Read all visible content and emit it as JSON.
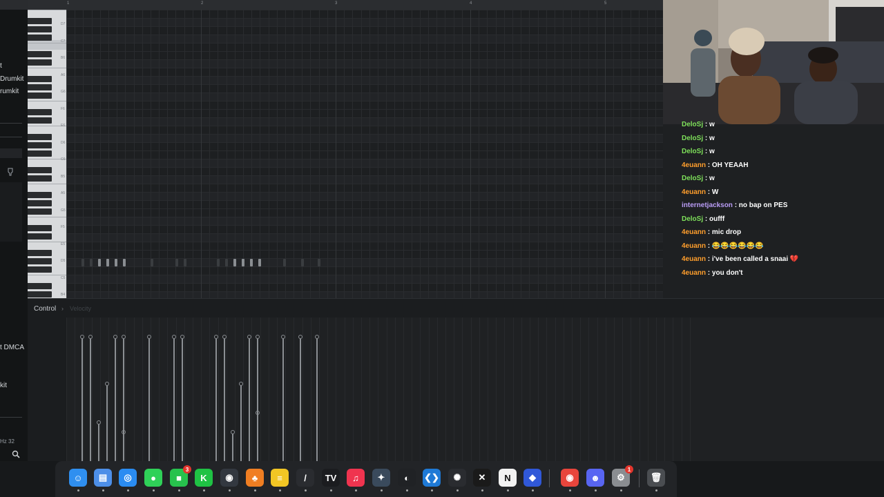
{
  "sidebar": {
    "items": [
      "t",
      "Drumkit",
      "rumkit",
      "t DMCA",
      "kit"
    ],
    "zoom_label": "Hz 32"
  },
  "ruler": {
    "bars": [
      "1",
      "2",
      "3",
      "4",
      "5"
    ]
  },
  "keys": {
    "labels": [
      "D7",
      "C7",
      "B6",
      "A6",
      "G6",
      "F6",
      "E6",
      "D6",
      "C6",
      "B5",
      "A5",
      "G5",
      "F5",
      "E5",
      "D5",
      "C5",
      "B4"
    ]
  },
  "control": {
    "label": "Control",
    "chevron": "›",
    "sub_label": "Velocity"
  },
  "chat": {
    "messages": [
      {
        "user": "DeloSj",
        "text": ": w",
        "color": "#7ee05a"
      },
      {
        "user": "DeloSj",
        "text": ": w",
        "color": "#7ee05a"
      },
      {
        "user": "DeloSj",
        "text": ": w",
        "color": "#7ee05a"
      },
      {
        "user": "4euann",
        "text": ": OH YEAAH",
        "color": "#ff9e2c"
      },
      {
        "user": "DeloSj",
        "text": ": w",
        "color": "#7ee05a"
      },
      {
        "user": "4euann",
        "text": ": W",
        "color": "#ff9e2c"
      },
      {
        "user": "internetjackson",
        "text": ": no bap on PES",
        "color": "#b99cf5"
      },
      {
        "user": "DeloSj",
        "text": ": oufff",
        "color": "#7ee05a"
      },
      {
        "user": "4euann",
        "text": ": mic drop",
        "color": "#ff9e2c"
      },
      {
        "user": "4euann",
        "text": ": 😂😂😂😂😂😂",
        "color": "#ff9e2c"
      },
      {
        "user": "4euann",
        "text": ": i've been called a snaai 💔",
        "color": "#ff9e2c"
      },
      {
        "user": "4euann",
        "text": ": you don't",
        "color": "#ff9e2c"
      }
    ]
  },
  "dock": {
    "apps": [
      {
        "name": "finder-icon",
        "glyph": "☺",
        "bg": "#2f8ff0"
      },
      {
        "name": "files-icon",
        "glyph": "▤",
        "bg": "#4d8fe8"
      },
      {
        "name": "safari-icon",
        "glyph": "◎",
        "bg": "#2a8cf2"
      },
      {
        "name": "messages-icon",
        "glyph": "●",
        "bg": "#2fd158"
      },
      {
        "name": "facetime-icon",
        "glyph": "■",
        "bg": "#27c24d",
        "badge": "3"
      },
      {
        "name": "kick-icon",
        "glyph": "K",
        "bg": "#1fc244"
      },
      {
        "name": "obs-icon",
        "glyph": "◉",
        "bg": "#333840"
      },
      {
        "name": "fl-studio-icon",
        "glyph": "♣",
        "bg": "#f07e22"
      },
      {
        "name": "notes-icon",
        "glyph": "≡",
        "bg": "#f2c624"
      },
      {
        "name": "stylus-icon",
        "glyph": "/",
        "bg": "#2a2c30"
      },
      {
        "name": "tradingview-icon",
        "glyph": "TV",
        "bg": "#1b1c1f"
      },
      {
        "name": "music-icon",
        "glyph": "♫",
        "bg": "#f0344f"
      },
      {
        "name": "davinci-icon",
        "glyph": "✦",
        "bg": "#3a4a5c"
      },
      {
        "name": "github-icon",
        "glyph": "◐",
        "bg": "#202225"
      },
      {
        "name": "vscode-icon",
        "glyph": "❮❯",
        "bg": "#1f7ad6"
      },
      {
        "name": "chatgpt-icon",
        "glyph": "✺",
        "bg": "#2a2c30"
      },
      {
        "name": "capcut-icon",
        "glyph": "✕",
        "bg": "#1a1a1a"
      },
      {
        "name": "notion-icon",
        "glyph": "N",
        "bg": "#f2f2f2"
      },
      {
        "name": "app-blue-icon",
        "glyph": "◆",
        "bg": "#3058d8"
      },
      {
        "name": "chrome-icon",
        "glyph": "◉",
        "bg": "#e8453c"
      },
      {
        "name": "discord-icon",
        "glyph": "☻",
        "bg": "#5865f2"
      },
      {
        "name": "settings-icon",
        "glyph": "⚙",
        "bg": "#8a8d91",
        "badge": "1"
      },
      {
        "name": "trash-icon",
        "glyph": "🗑",
        "bg": "#4a4d51"
      }
    ]
  }
}
